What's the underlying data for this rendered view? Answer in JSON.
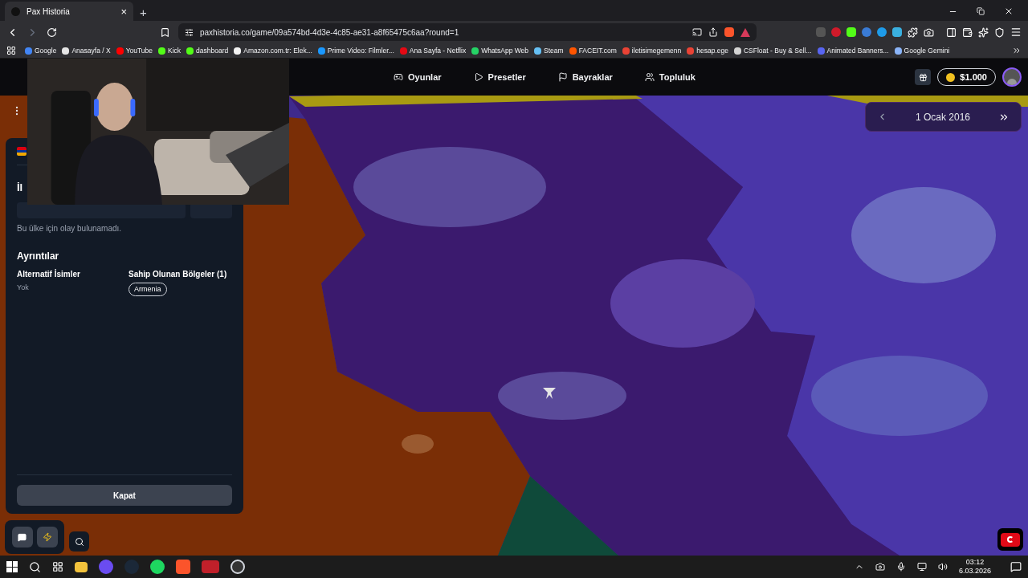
{
  "browser": {
    "tab": {
      "title": "Pax Historia",
      "close": "×"
    },
    "new_tab": "+",
    "url": "paxhistoria.co/game/09a574bd-4d3e-4c85-ae31-a8f65475c6aa?round=1",
    "bookmarks": [
      {
        "label": "Google",
        "color": "#4285f4"
      },
      {
        "label": "Anasayfa / X",
        "color": "#e5e5e5"
      },
      {
        "label": "YouTube",
        "color": "#ff0000"
      },
      {
        "label": "Kick",
        "color": "#53fc18"
      },
      {
        "label": "dashboard",
        "color": "#53fc18"
      },
      {
        "label": "Amazon.com.tr: Elek...",
        "color": "#f3f3f3"
      },
      {
        "label": "Prime Video: Filmler...",
        "color": "#1a98ff"
      },
      {
        "label": "Ana Sayfa - Netflix",
        "color": "#e50914"
      },
      {
        "label": "WhatsApp Web",
        "color": "#25d366"
      },
      {
        "label": "Steam",
        "color": "#66c0f4"
      },
      {
        "label": "FACEIT.com",
        "color": "#ff5500"
      },
      {
        "label": "iletisimegemenn",
        "color": "#ea4335"
      },
      {
        "label": "hesap.ege",
        "color": "#ea4335"
      },
      {
        "label": "CSFloat - Buy & Sell...",
        "color": "#d4d4d4"
      },
      {
        "label": "Animated Banners...",
        "color": "#5865f2"
      },
      {
        "label": "Google Gemini",
        "color": "#8ab4f8"
      }
    ]
  },
  "game": {
    "nav": [
      {
        "label": "Oyunlar",
        "kind": "games"
      },
      {
        "label": "Presetler",
        "kind": "presets"
      },
      {
        "label": "Bayraklar",
        "kind": "flags"
      },
      {
        "label": "Topluluk",
        "kind": "community"
      }
    ],
    "balance": "$1.000",
    "date": "1 Ocak 2016",
    "panel": {
      "heading": "İl",
      "empty_message": "Bu ülke için olay bulunamadı.",
      "details_title": "Ayrıntılar",
      "fields": [
        {
          "label": "Alternatif İsimler",
          "value": "Yok"
        },
        {
          "label": "Sahip Olunan Bölgeler (1)",
          "tags": [
            "Armenia"
          ]
        }
      ],
      "close_button": "Kapat"
    }
  },
  "taskbar": {
    "time": "03:12",
    "date": "6.03.2026"
  }
}
